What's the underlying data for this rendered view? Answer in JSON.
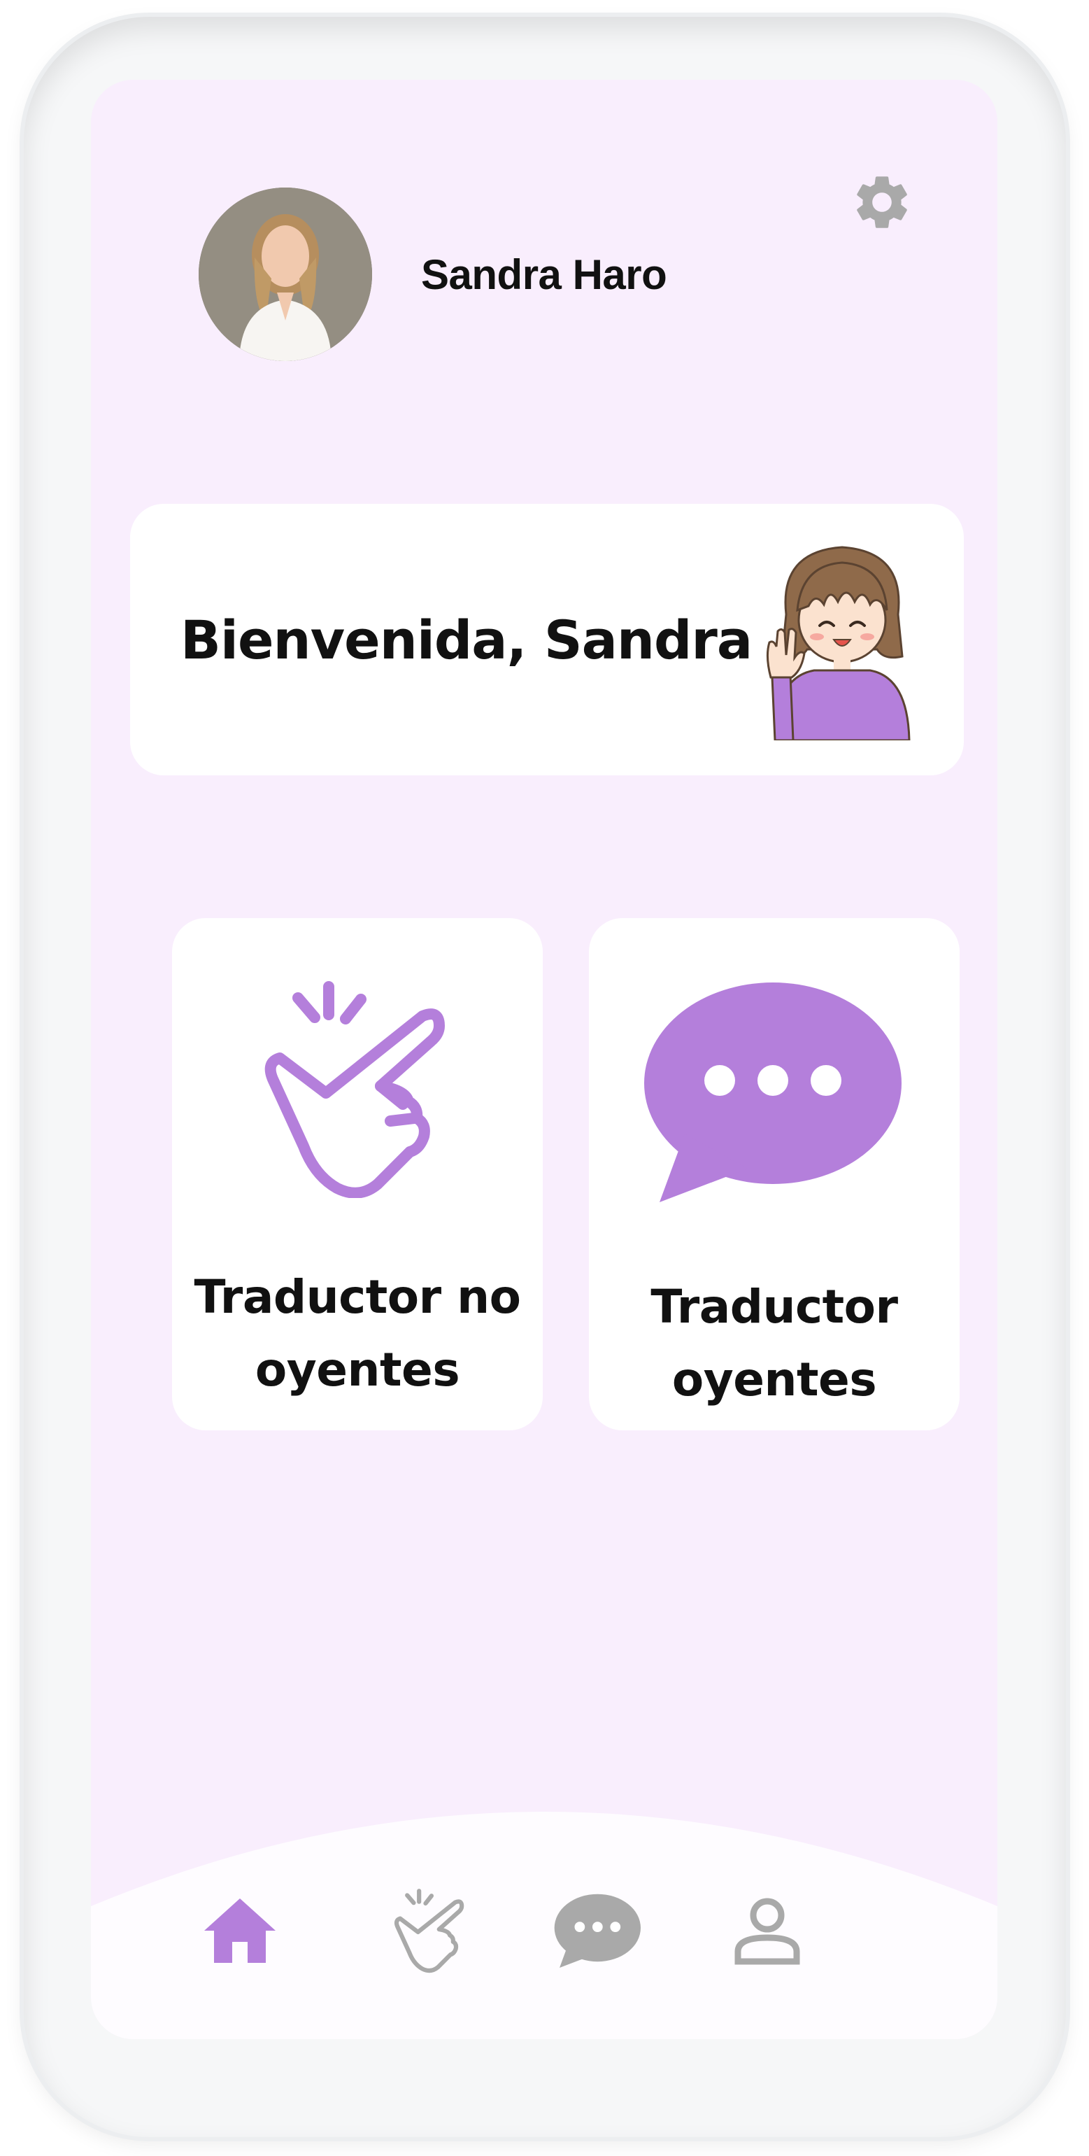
{
  "user": {
    "name": "Sandra Haro"
  },
  "welcome": {
    "text": "Bienvenida, Sandra"
  },
  "cards": [
    {
      "label": "Traductor no\noyentes",
      "icon": "snap-hand-icon"
    },
    {
      "label": "Traductor\noyentes",
      "icon": "speech-bubble-icon"
    }
  ],
  "nav": [
    {
      "icon": "home-icon",
      "active": true
    },
    {
      "icon": "snap-hand-icon",
      "active": false
    },
    {
      "icon": "chat-bubble-icon",
      "active": false
    },
    {
      "icon": "user-icon",
      "active": false
    }
  ],
  "colors": {
    "accent": "#b47fdb",
    "background": "#f9eefd",
    "inactive": "#a9a9a9"
  }
}
